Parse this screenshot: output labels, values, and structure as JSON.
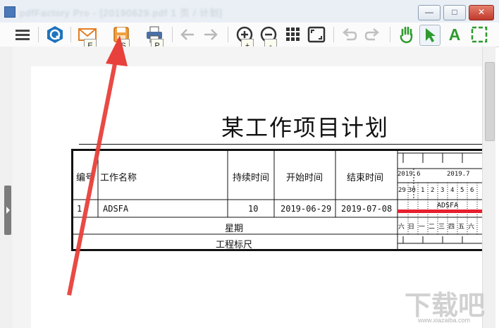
{
  "window": {
    "title": "pdfFactory Pro - [20190629.pdf 1 页 / 计划]",
    "min_label": "—",
    "max_label": "□",
    "close_label": "✕"
  },
  "toolbar": {
    "icons": [
      "menu-icon",
      "q-logo-icon",
      "email-icon",
      "save-icon",
      "print-icon",
      "back-arrow-icon",
      "forward-arrow-icon",
      "zoom-in-icon",
      "zoom-out-icon",
      "grid-icon",
      "fit-page-icon",
      "undo-icon",
      "redo-icon",
      "hand-icon",
      "select-arrow-icon",
      "text-tool-icon",
      "crop-icon"
    ],
    "text_tool_label": "A",
    "shortcuts": {
      "email": "E",
      "save": "S",
      "print": "P",
      "zoom_in": "+",
      "zoom_out": "-"
    }
  },
  "document": {
    "title": "某工作项目计划",
    "headers": {
      "index": "编号",
      "task_name": "工作名称",
      "duration": "持续时间",
      "start": "开始时间",
      "end": "结束时间"
    },
    "rows": [
      {
        "index": "1",
        "task_name": "ADSFA",
        "duration": "10",
        "start": "2019-06-29",
        "end": "2019-07-08"
      }
    ],
    "weekday_label": "星期",
    "ruler_label": "工程标尺",
    "gantt": {
      "months": [
        "2019.6",
        "2019.7"
      ],
      "days": [
        "29",
        "30",
        "1",
        "2",
        "3",
        "4",
        "5",
        "6"
      ],
      "weekdays": [
        "六",
        "日",
        "一",
        "二",
        "三",
        "四",
        "五",
        "六"
      ],
      "task_label": "ADSFA",
      "bar_color": "#e8212e"
    }
  },
  "watermark": {
    "text": "下载吧",
    "url": "www.xiazaiba.com"
  },
  "annotation": {
    "arrow_color": "#e8403a"
  }
}
